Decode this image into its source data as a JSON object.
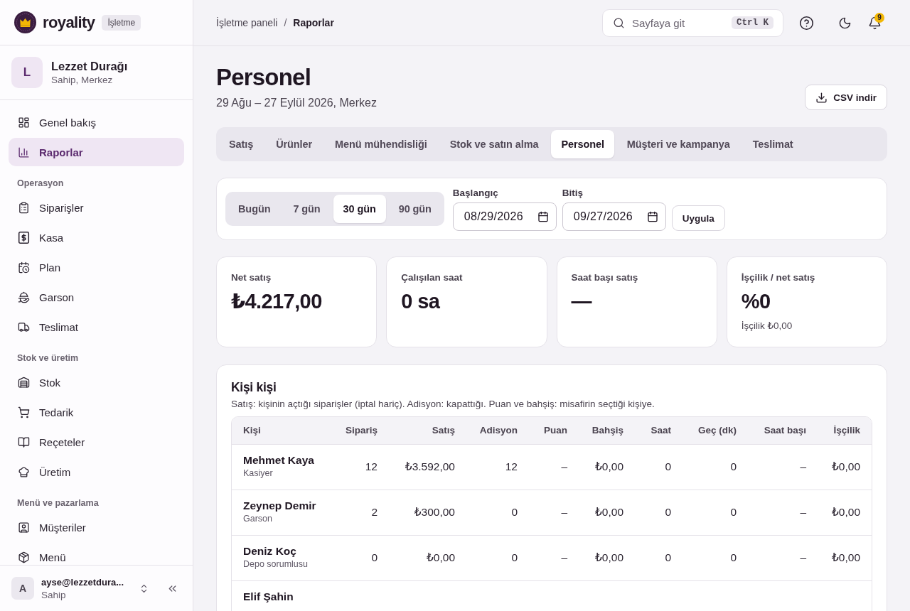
{
  "brand": {
    "name": "royality",
    "badge": "İşletme"
  },
  "organization": {
    "initial": "L",
    "name": "Lezzet Durağı",
    "subtitle": "Sahip, Merkez"
  },
  "sidebar": {
    "sections": [
      {
        "items": [
          {
            "label": "Genel bakış",
            "selected": false
          },
          {
            "label": "Raporlar",
            "selected": true
          }
        ]
      },
      {
        "title": "Operasyon",
        "items": [
          {
            "label": "Siparişler",
            "selected": false
          },
          {
            "label": "Kasa",
            "selected": false
          },
          {
            "label": "Plan",
            "selected": false
          },
          {
            "label": "Garson",
            "selected": false
          },
          {
            "label": "Teslimat",
            "selected": false
          }
        ]
      },
      {
        "title": "Stok ve üretim",
        "items": [
          {
            "label": "Stok",
            "selected": false
          },
          {
            "label": "Tedarik",
            "selected": false
          },
          {
            "label": "Reçeteler",
            "selected": false
          },
          {
            "label": "Üretim",
            "selected": false
          }
        ]
      },
      {
        "title": "Menü ve pazarlama",
        "items": [
          {
            "label": "Müşteriler",
            "selected": false
          },
          {
            "label": "Menü",
            "selected": false
          }
        ]
      }
    ]
  },
  "user": {
    "initial": "A",
    "email": "ayse@lezzetdura...",
    "role": "Sahip"
  },
  "breadcrumb": {
    "items": [
      "İşletme paneli",
      "Raporlar"
    ],
    "separator": "/"
  },
  "search": {
    "placeholder": "Sayfaya git",
    "shortcut": "Ctrl K"
  },
  "notifications": {
    "count": "9"
  },
  "page": {
    "title": "Personel",
    "subtitle": "29 Ağu – 27 Eylül 2026, Merkez",
    "export_button": "CSV indir"
  },
  "tabs": [
    {
      "label": "Satış",
      "selected": false
    },
    {
      "label": "Ürünler",
      "selected": false
    },
    {
      "label": "Menü mühendisliği",
      "selected": false
    },
    {
      "label": "Stok ve satın alma",
      "selected": false
    },
    {
      "label": "Personel",
      "selected": true
    },
    {
      "label": "Müşteri ve kampanya",
      "selected": false
    },
    {
      "label": "Teslimat",
      "selected": false
    }
  ],
  "filters": {
    "presets": [
      {
        "label": "Bugün",
        "selected": false
      },
      {
        "label": "7 gün",
        "selected": false
      },
      {
        "label": "30 gün",
        "selected": true
      },
      {
        "label": "90 gün",
        "selected": false
      }
    ],
    "start": {
      "label": "Başlangıç",
      "value": "08/29/2026"
    },
    "end": {
      "label": "Bitiş",
      "value": "09/27/2026"
    },
    "apply_button": "Uygula"
  },
  "kpis": [
    {
      "label": "Net satış",
      "value": "₺4.217,00"
    },
    {
      "label": "Çalışılan saat",
      "value": "0 sa"
    },
    {
      "label": "Saat başı satış",
      "value": "—"
    },
    {
      "label": "İşçilik / net satış",
      "value": "%0",
      "note": "İşçilik ₺0,00"
    }
  ],
  "staff_table": {
    "title": "Kişi kişi",
    "description": "Satış: kişinin açtığı siparişler (iptal hariç). Adisyon: kapattığı. Puan ve bahşiş: misafirin seçtiği kişiye.",
    "columns": [
      "Kişi",
      "Sipariş",
      "Satış",
      "Adisyon",
      "Puan",
      "Bahşiş",
      "Saat",
      "Geç (dk)",
      "Saat başı",
      "İşçilik"
    ],
    "rows": [
      {
        "name": "Mehmet Kaya",
        "role": "Kasiyer",
        "values": [
          "12",
          "₺3.592,00",
          "12",
          "–",
          "₺0,00",
          "0",
          "0",
          "–",
          "₺0,00"
        ]
      },
      {
        "name": "Zeynep Demir",
        "role": "Garson",
        "values": [
          "2",
          "₺300,00",
          "0",
          "–",
          "₺0,00",
          "0",
          "0",
          "–",
          "₺0,00"
        ]
      },
      {
        "name": "Deniz Koç",
        "role": "Depo sorumlusu",
        "values": [
          "0",
          "₺0,00",
          "0",
          "–",
          "₺0,00",
          "0",
          "0",
          "–",
          "₺0,00"
        ]
      },
      {
        "name": "Elif Şahin"
      }
    ]
  }
}
